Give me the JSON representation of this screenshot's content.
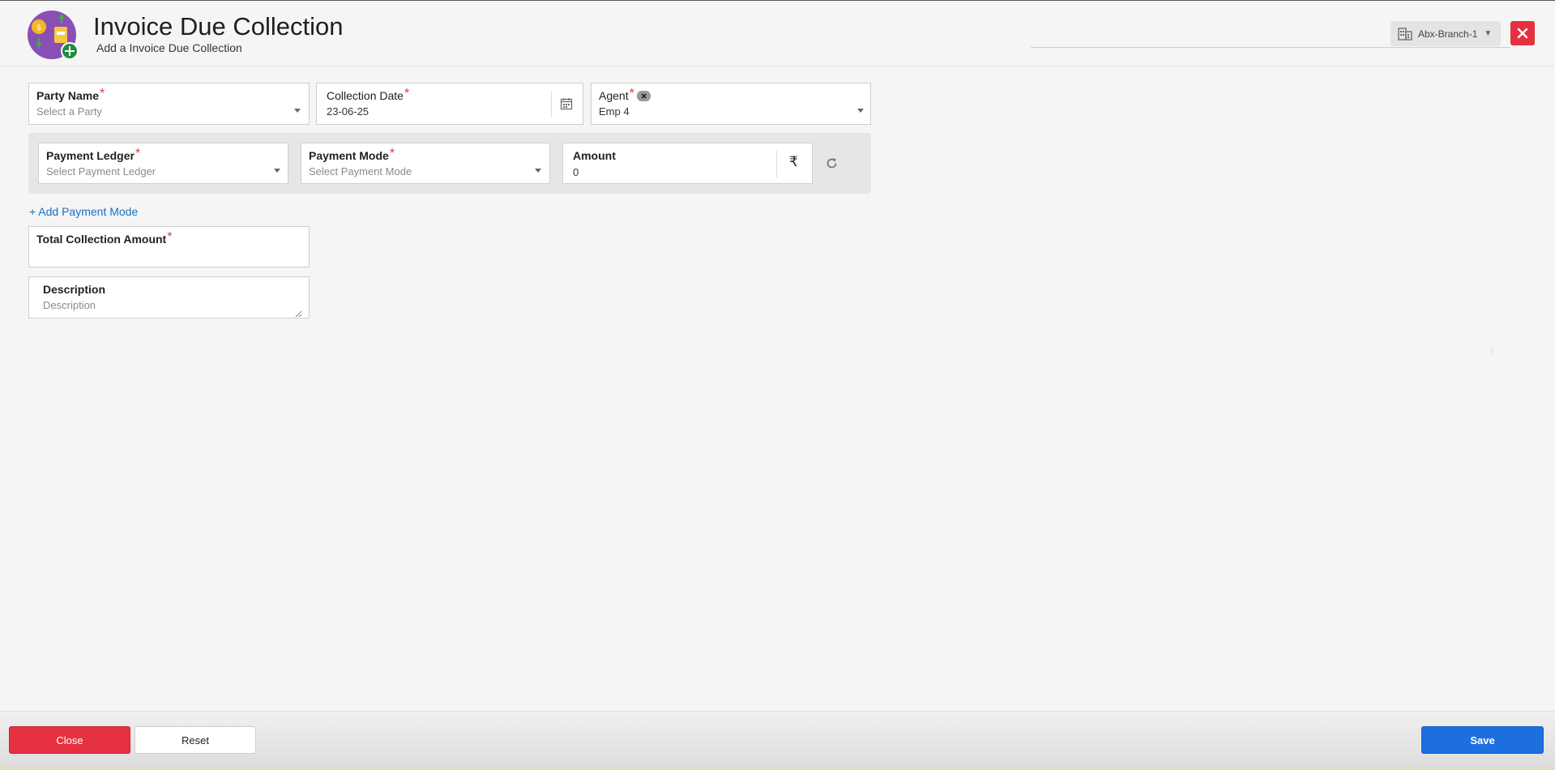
{
  "header": {
    "title": "Invoice Due Collection",
    "subtitle": "Add a Invoice Due Collection",
    "branch": "Abx-Branch-1"
  },
  "form": {
    "party_name": {
      "label": "Party Name",
      "placeholder": "Select a Party",
      "required": "*"
    },
    "collection_date": {
      "label": "Collection Date",
      "value": "23-06-25",
      "required": "*"
    },
    "agent": {
      "label": "Agent",
      "value": "Emp 4",
      "required": "*"
    },
    "payment_ledger": {
      "label": "Payment Ledger",
      "placeholder": "Select Payment Ledger",
      "required": "*"
    },
    "payment_mode": {
      "label": "Payment Mode",
      "placeholder": "Select Payment Mode",
      "required": "*"
    },
    "amount": {
      "label": "Amount",
      "value": "0",
      "currency": "₹"
    },
    "add_payment_mode": "+ Add Payment Mode",
    "total_collection_amount": {
      "label": "Total Collection Amount",
      "value": "",
      "required": "*"
    },
    "description": {
      "label": "Description",
      "placeholder": "Description"
    }
  },
  "footer": {
    "close_label": "Close",
    "reset_label": "Reset",
    "save_label": "Save"
  },
  "colors": {
    "danger": "#e4303f",
    "primary": "#1d6fe0",
    "link": "#1a6fc4",
    "required": "#e43b3b"
  },
  "icons": [
    "collection-logo-icon",
    "building-icon",
    "close-icon",
    "calendar-icon",
    "rupee-icon",
    "refresh-icon",
    "chevron-right-icon",
    "chevron-down-icon",
    "clear-icon",
    "resize-handle-icon"
  ]
}
